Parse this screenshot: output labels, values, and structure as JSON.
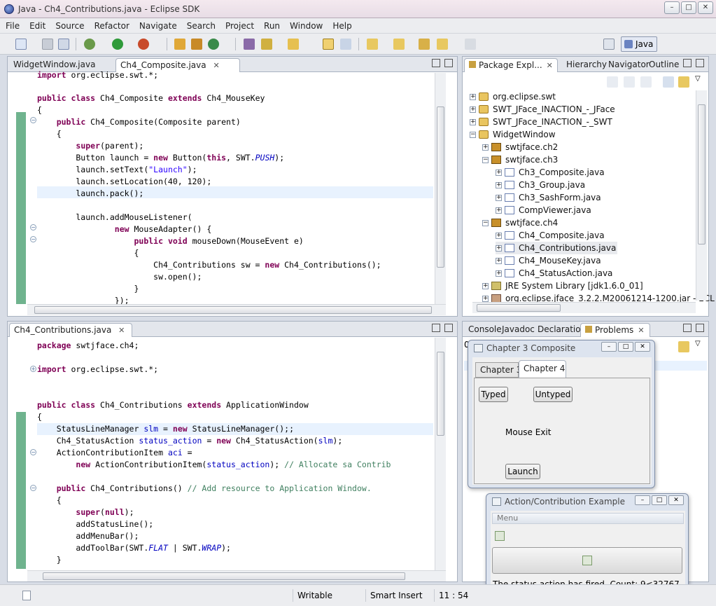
{
  "window": {
    "title": "Java - Ch4_Contributions.java - Eclipse SDK",
    "min": "–",
    "max": "□",
    "close": "✕"
  },
  "menu": [
    "File",
    "Edit",
    "Source",
    "Refactor",
    "Navigate",
    "Search",
    "Project",
    "Run",
    "Window",
    "Help"
  ],
  "toolbar": {
    "perspective": "Java"
  },
  "editor_top": {
    "tabs": [
      {
        "label": "WidgetWindow.java"
      },
      {
        "label": "Ch4_Composite.java"
      }
    ],
    "close_glyph": "✕"
  },
  "editor_bottom": {
    "tabs": [
      {
        "label": "Ch4_Contributions.java"
      }
    ],
    "close_glyph": "✕"
  },
  "package_explorer": {
    "tabs": [
      "Package Expl...",
      "Hierarchy",
      "Navigator",
      "Outline"
    ],
    "items": [
      "org.eclipse.swt",
      "SWT_JFace_INACTION_-_JFace",
      "SWT_JFace_INACTION_-_SWT",
      "WidgetWindow",
      "swtjface.ch2",
      "swtjface.ch3",
      "Ch3_Composite.java",
      "Ch3_Group.java",
      "Ch3_SashForm.java",
      "CompViewer.java",
      "swtjface.ch4",
      "Ch4_Composite.java",
      "Ch4_Contributions.java",
      "Ch4_MouseKey.java",
      "Ch4_StatusAction.java",
      "JRE System Library [jdk1.6.0_01]",
      "org.eclipse.jface_3.2.2.M20061214-1200.jar - ECL"
    ]
  },
  "bottom_views": {
    "tabs": [
      "Console",
      "Javadoc",
      "Declaration",
      "Problems"
    ],
    "problems_prefix": "0"
  },
  "dialog_composite": {
    "title": "Chapter 3 Composite",
    "tabs": [
      "Chapter 3",
      "Chapter 4"
    ],
    "buttons": {
      "typed": "Typed",
      "untyped": "Untyped",
      "launch": "Launch"
    },
    "mouse_label": "Mouse Exit"
  },
  "dialog_action": {
    "title": "Action/Contribution Example",
    "menu": "Menu",
    "status": "The status action has fired. Count: 9<32767"
  },
  "statusbar": {
    "writable": "Writable",
    "insert_mode": "Smart Insert",
    "position": "11 : 54"
  }
}
